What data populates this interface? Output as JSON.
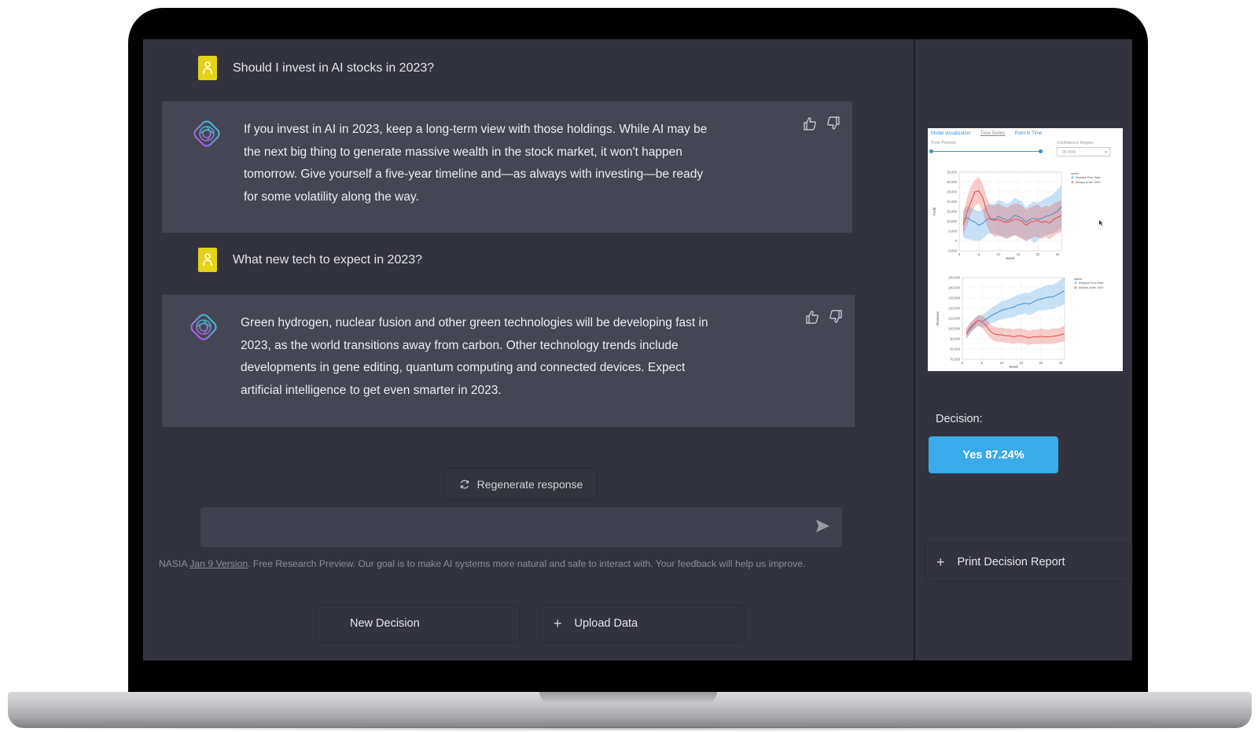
{
  "conversation": [
    {
      "role": "user",
      "text": "Should I invest in AI stocks in 2023?"
    },
    {
      "role": "assistant",
      "lines": [
        "If you invest in AI in 2023, keep a long-term view with those holdings. While AI may be",
        "the next big thing to generate massive wealth in the stock market, it won't happen",
        "tomorrow. Give yourself a five-year timeline and—as always with investing—be ready",
        "for some volatility along the way."
      ]
    },
    {
      "role": "user",
      "text": "What new tech to expect in 2023?"
    },
    {
      "role": "assistant",
      "lines": [
        "Green hydrogen, nuclear fusion and other green technologies will be developing fast in",
        "2023, as the world transitions away from carbon. Other technology trends include",
        "developments in gene editing, quantum computing and connected devices. Expect",
        "artificial intelligence to get even smarter in 2023."
      ]
    }
  ],
  "icons": {
    "user_avatar": "user-icon",
    "assistant_avatar": "assistant-logo-icon",
    "thumbs_up": "thumbs-up-icon",
    "thumbs_down": "thumbs-down-icon",
    "regenerate": "refresh-icon",
    "send": "send-icon",
    "plus": "plus-icon"
  },
  "regenerate_label": "Regenerate response",
  "input": {
    "value": "",
    "placeholder": ""
  },
  "footer": {
    "brand": "NASIA",
    "link_text": "Jan 9 Version",
    "rest": ". Free Research Preview. Our goal is to make AI systems more natural and safe to interact with. Your feedback will help us improve."
  },
  "buttons": {
    "new_decision": "New Decision",
    "upload_data": "Upload Data",
    "print_report": "Print Decision Report",
    "plus_glyph": "+"
  },
  "decision": {
    "label": "Decision:",
    "value": "Yes 87.24%",
    "color": "#39aaea"
  },
  "chart_panel": {
    "tabs": [
      "Model visualization",
      "Time Series",
      "Point in Time"
    ],
    "active_tab": "Time Series",
    "time_periods_label": "Time Periods",
    "confidence_label": "Confidence Region",
    "confidence_value": "90-95%"
  },
  "chart_data": [
    {
      "type": "area",
      "title": "",
      "xlabel": "Week",
      "ylabel": "Profit",
      "xlim": [
        0,
        26
      ],
      "ylim": [
        -5000,
        35000
      ],
      "xticks": [
        "0",
        "5",
        "10",
        "15",
        "20",
        "25"
      ],
      "yticks": [
        "-5,000",
        "0",
        "5,000",
        "10,000",
        "15,000",
        "20,000",
        "25,000",
        "30,000",
        "35,000"
      ],
      "legend_title": "option",
      "legend_position": "right",
      "x": [
        1,
        2,
        3,
        4,
        5,
        6,
        7,
        8,
        9,
        10,
        11,
        12,
        13,
        14,
        15,
        16,
        17,
        18,
        19,
        20,
        21,
        22,
        23,
        24,
        25,
        26
      ],
      "series": [
        {
          "name": "Replace Prev Sale",
          "color": "#4a9be0",
          "values": [
            9000,
            12000,
            10500,
            9500,
            8000,
            9000,
            11000,
            11500,
            11000,
            12500,
            11500,
            10500,
            11000,
            13000,
            12500,
            11500,
            9500,
            11000,
            11500,
            11000,
            11500,
            12500,
            13000,
            14000,
            15000,
            17500
          ],
          "lower": [
            2000,
            1000,
            500,
            200,
            0,
            1000,
            3000,
            4000,
            3500,
            3000,
            2500,
            1500,
            2000,
            3000,
            2500,
            1500,
            0,
            1000,
            -1000,
            500,
            2000,
            3000,
            3500,
            4000,
            5000,
            7000
          ],
          "upper": [
            15000,
            18000,
            17000,
            16000,
            15000,
            16000,
            18000,
            19000,
            19000,
            21000,
            20000,
            19000,
            19500,
            22000,
            21000,
            20000,
            17000,
            19000,
            20000,
            19500,
            20500,
            22000,
            22500,
            24000,
            26000,
            28500
          ]
        },
        {
          "name": "Always order 1000",
          "color": "#e4574f",
          "values": [
            8000,
            15000,
            20000,
            25000,
            25500,
            22000,
            15000,
            11000,
            10500,
            11000,
            10000,
            9500,
            10000,
            11000,
            11000,
            10000,
            8000,
            9500,
            10000,
            10500,
            9500,
            10000,
            9000,
            11000,
            12000,
            13000
          ],
          "lower": [
            3000,
            8000,
            14000,
            18000,
            19000,
            15000,
            8000,
            4000,
            2000,
            2500,
            2000,
            1000,
            2000,
            3000,
            2000,
            1000,
            0,
            1000,
            2000,
            2000,
            1000,
            2000,
            1000,
            2500,
            4000,
            4500
          ],
          "upper": [
            14000,
            22000,
            28000,
            31000,
            32500,
            29000,
            22000,
            18000,
            18000,
            19000,
            18000,
            17000,
            18000,
            19000,
            19000,
            18000,
            16000,
            17000,
            18000,
            18500,
            17000,
            18000,
            17500,
            19000,
            20000,
            21000
          ]
        }
      ]
    },
    {
      "type": "area",
      "title": "",
      "xlabel": "Week",
      "ylabel": "Revenue",
      "xlim": [
        0,
        26
      ],
      "ylim": [
        70000,
        150000
      ],
      "xticks": [
        "0",
        "5",
        "10",
        "15",
        "20",
        "25"
      ],
      "yticks": [
        "70,000",
        "80,000",
        "90,000",
        "100,000",
        "110,000",
        "120,000",
        "130,000",
        "140,000",
        "150,000"
      ],
      "legend_title": "option",
      "legend_position": "right",
      "x": [
        1,
        2,
        3,
        4,
        5,
        6,
        7,
        8,
        9,
        10,
        11,
        12,
        13,
        14,
        15,
        16,
        17,
        18,
        19,
        20,
        21,
        22,
        23,
        24,
        25,
        26
      ],
      "series": [
        {
          "name": "Replace Prev Sale",
          "color": "#4a9be0",
          "values": [
            95000,
            100000,
            104000,
            108000,
            107000,
            109000,
            112000,
            114000,
            116000,
            118000,
            119000,
            120000,
            121000,
            123000,
            124000,
            125000,
            124000,
            126000,
            128000,
            129000,
            130000,
            131000,
            131000,
            133000,
            135000,
            137000
          ],
          "lower": [
            91000,
            95000,
            99000,
            103000,
            101000,
            102000,
            105000,
            106000,
            108000,
            109000,
            110000,
            111000,
            111000,
            113000,
            114000,
            115000,
            113000,
            115000,
            117000,
            118000,
            118000,
            119000,
            119000,
            121000,
            122000,
            124000
          ],
          "upper": [
            99000,
            105000,
            109000,
            113000,
            113000,
            116000,
            119000,
            122000,
            124000,
            127000,
            128000,
            129000,
            131000,
            133000,
            134000,
            135000,
            135000,
            137000,
            139000,
            140000,
            142000,
            143000,
            143000,
            145000,
            148000,
            150000
          ]
        },
        {
          "name": "Always order 1000",
          "color": "#e4574f",
          "values": [
            95000,
            101000,
            105000,
            108000,
            107000,
            103000,
            98000,
            95000,
            94000,
            94000,
            93000,
            93000,
            92000,
            93000,
            93000,
            92000,
            91000,
            92000,
            92000,
            92500,
            92000,
            92000,
            92500,
            93000,
            94000,
            95000
          ],
          "lower": [
            90000,
            96000,
            100000,
            103000,
            101000,
            96000,
            91000,
            88000,
            87000,
            87000,
            86000,
            86000,
            85000,
            86000,
            86000,
            85000,
            84000,
            85000,
            85000,
            85000,
            85000,
            85000,
            85000,
            86000,
            87000,
            87000
          ],
          "upper": [
            100000,
            106000,
            110000,
            113000,
            113000,
            110000,
            105000,
            102000,
            101000,
            101000,
            100000,
            100000,
            99000,
            100000,
            100000,
            99000,
            98000,
            99000,
            99000,
            100000,
            99000,
            99000,
            100000,
            100000,
            101000,
            103000
          ]
        }
      ]
    }
  ]
}
